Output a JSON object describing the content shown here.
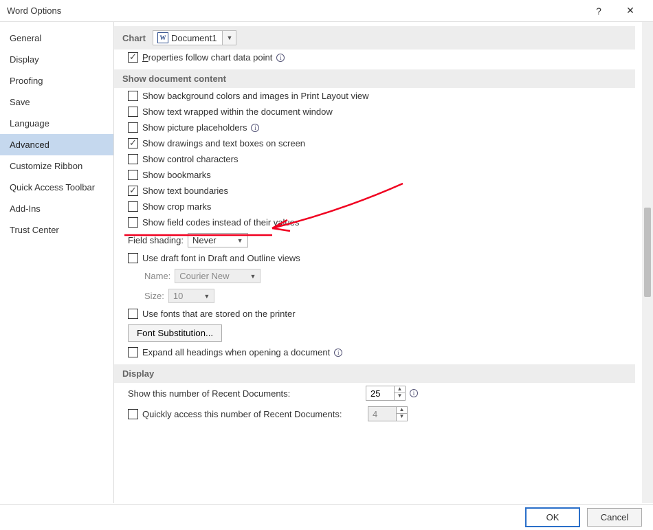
{
  "window": {
    "title": "Word Options",
    "help_icon": "?",
    "close_icon": "✕"
  },
  "sidebar": {
    "items": [
      {
        "label": "General"
      },
      {
        "label": "Display"
      },
      {
        "label": "Proofing"
      },
      {
        "label": "Save"
      },
      {
        "label": "Language"
      },
      {
        "label": "Advanced",
        "selected": true
      },
      {
        "label": "Customize Ribbon"
      },
      {
        "label": "Quick Access Toolbar"
      },
      {
        "label": "Add-Ins"
      },
      {
        "label": "Trust Center"
      }
    ]
  },
  "chart_section": {
    "heading": "Chart",
    "document_combo": "Document1",
    "prop_follow": "Properties follow chart data point"
  },
  "doc_content": {
    "heading": "Show document content",
    "bg": "Show background colors and images in Print Layout view",
    "wrap": "Show text wrapped within the document window",
    "pic": "Show picture placeholders",
    "draw": "Show drawings and text boxes on screen",
    "ctrl": "Show control characters",
    "book": "Show bookmarks",
    "bound": "Show text boundaries",
    "crop": "Show crop marks",
    "field": "Show field codes instead of their values",
    "shading_label": "Field shading:",
    "shading_value": "Never",
    "draft": "Use draft font in Draft and Outline views",
    "name_label": "Name:",
    "name_value": "Courier New",
    "size_label": "Size:",
    "size_value": "10",
    "printer_fonts": "Use fonts that are stored on the printer",
    "font_sub_btn": "Font Substitution...",
    "expand": "Expand all headings when opening a document"
  },
  "display_section": {
    "heading": "Display",
    "recent_label": "Show this number of Recent Documents:",
    "recent_value": "25",
    "quick_label": "Quickly access this number of Recent Documents:",
    "quick_value": "4"
  },
  "footer": {
    "ok": "OK",
    "cancel": "Cancel"
  },
  "info_glyph": "i"
}
